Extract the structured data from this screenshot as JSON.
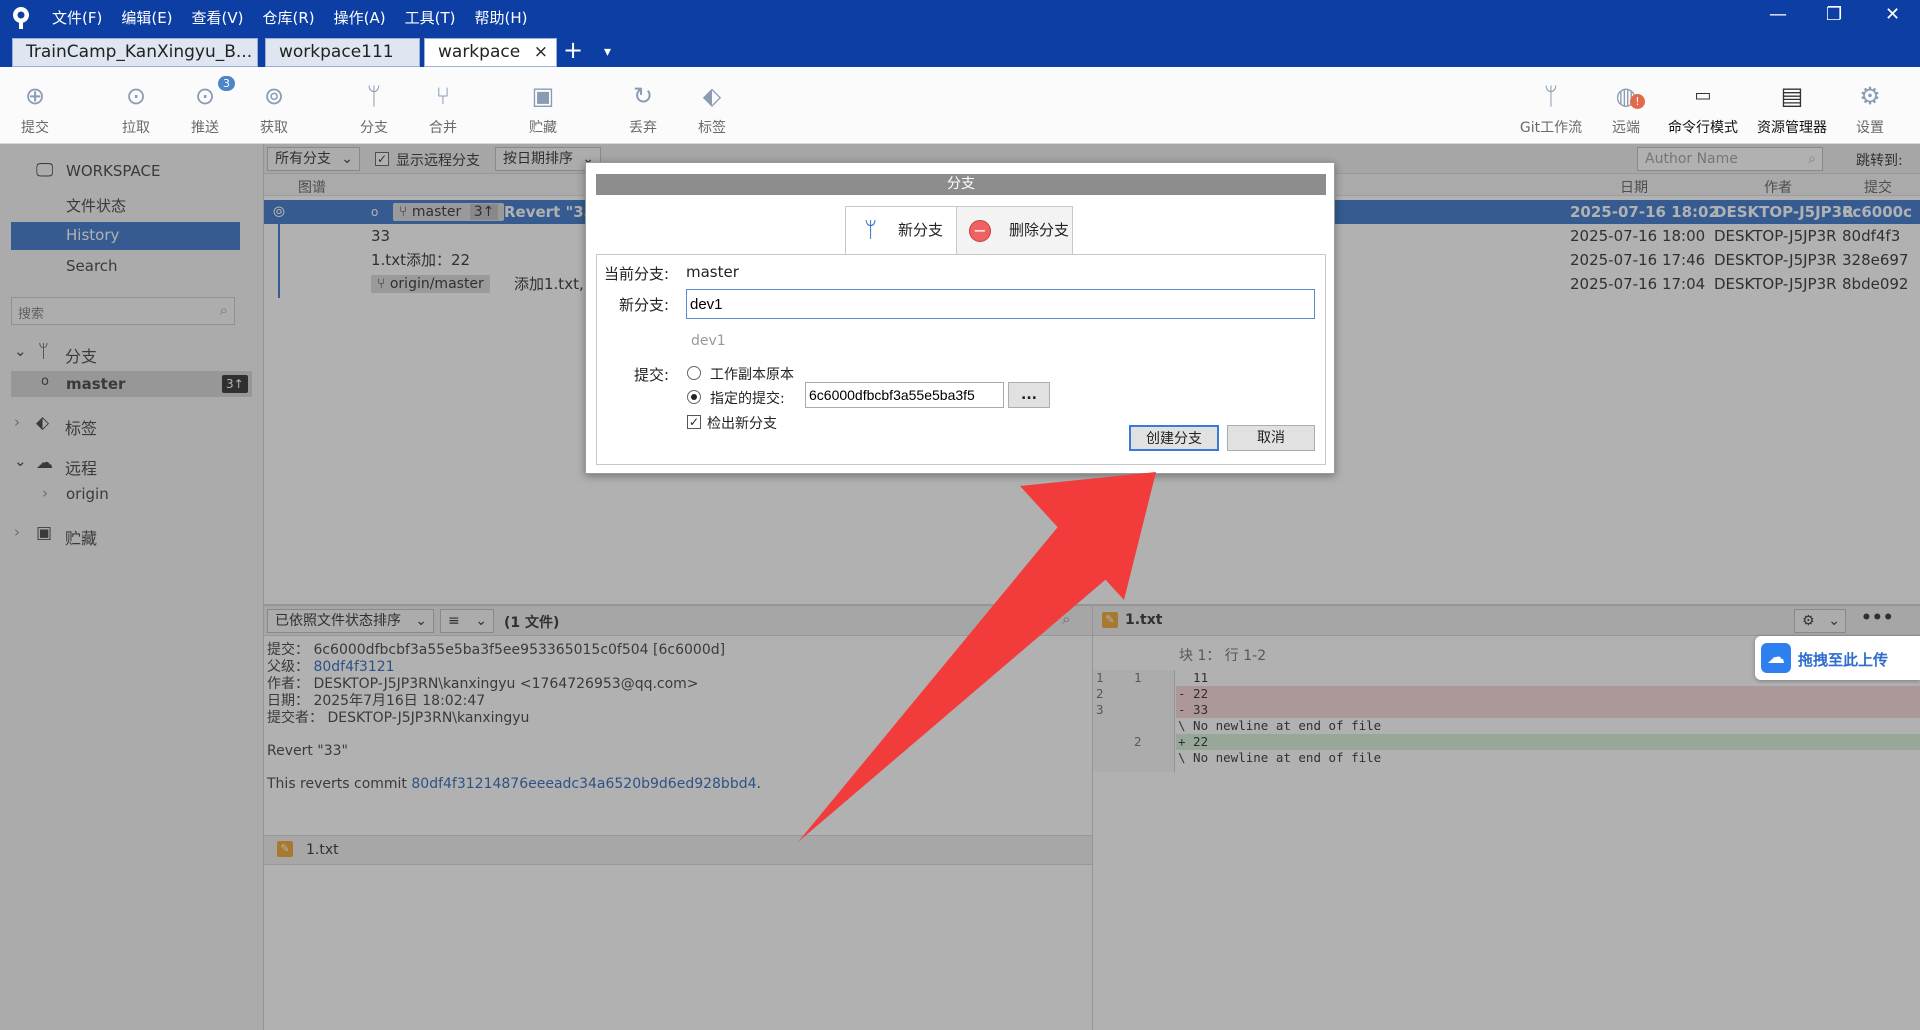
{
  "menu": [
    "文件(F)",
    "编辑(E)",
    "查看(V)",
    "仓库(R)",
    "操作(A)",
    "工具(T)",
    "帮助(H)"
  ],
  "tabs": [
    {
      "label": "TrainCamp_KanXingyu_B..."
    },
    {
      "label": "workpace111"
    },
    {
      "label": "warkpace",
      "close": "×"
    }
  ],
  "tab_add": "+",
  "tab_menu": "▾",
  "window_controls": {
    "minimize": "—",
    "restore": "❐",
    "close": "✕"
  },
  "toolbar": {
    "left": [
      {
        "label": "提交",
        "icon": "commit-icon"
      },
      {
        "label": "拉取",
        "icon": "pull-icon"
      },
      {
        "label": "推送",
        "icon": "push-icon",
        "badge": "3"
      },
      {
        "label": "获取",
        "icon": "fetch-icon"
      },
      {
        "label": "分支",
        "icon": "branch-icon"
      },
      {
        "label": "合并",
        "icon": "merge-icon"
      },
      {
        "label": "贮藏",
        "icon": "stash-icon"
      },
      {
        "label": "丢弃",
        "icon": "discard-icon"
      },
      {
        "label": "标签",
        "icon": "tag-icon"
      }
    ],
    "right": [
      {
        "label": "Git工作流",
        "icon": "git-flow-icon"
      },
      {
        "label": "远端",
        "icon": "remote-icon"
      },
      {
        "label": "命令行模式",
        "icon": "terminal-icon"
      },
      {
        "label": "资源管理器",
        "icon": "explorer-icon"
      },
      {
        "label": "设置",
        "icon": "gear-icon"
      }
    ]
  },
  "sidebar": {
    "workspace": "WORKSPACE",
    "items": [
      "文件状态",
      "History",
      "Search"
    ],
    "search_placeholder": "搜索",
    "branches": "分支",
    "master": "master",
    "master_badge": "3↑",
    "tags": "标签",
    "remotes": "远程",
    "origin": "origin",
    "stash": "贮藏"
  },
  "filterbar": {
    "branch_filter": "所有分支",
    "show_remote": "显示远程分支",
    "sort": "按日期排序",
    "author_placeholder": "Author Name",
    "jump": "跳转到:"
  },
  "columns": {
    "graph": "图谱",
    "date": "日期",
    "author": "作者",
    "commit": "提交"
  },
  "commits": [
    {
      "branch": "master",
      "badge": "3↑",
      "message": "Revert \"33",
      "date": "2025-07-16 18:02",
      "author": "DESKTOP-J5JP3R",
      "hash": "6c6000c"
    },
    {
      "message": "33",
      "date": "2025-07-16 18:00",
      "author": "DESKTOP-J5JP3R",
      "hash": "80df4f3"
    },
    {
      "message": "1.txt添加：22",
      "date": "2025-07-16 17:46",
      "author": "DESKTOP-J5JP3R",
      "hash": "328e697"
    },
    {
      "branch": "origin/master",
      "message": "添加1.txt,",
      "date": "2025-07-16 17:04",
      "author": "DESKTOP-J5JP3R",
      "hash": "8bde092"
    }
  ],
  "detail": {
    "sort": "已依照文件状态排序",
    "view": "≡",
    "count": "(1 文件)",
    "commit_label": "提交：",
    "commit": "6c6000dfbcbf3a55e5ba3f5ee953365015c0f504 [6c6000d]",
    "parent_label": "父级：",
    "parent": "80df4f3121",
    "author_label": "作者：",
    "author": "DESKTOP-J5JP3RN\\kanxingyu <1764726953@qq.com>",
    "date_label": "日期：",
    "date": "2025年7月16日 18:02:47",
    "committer_label": "提交者：",
    "committer": "DESKTOP-J5JP3RN\\kanxingyu",
    "msg1": "Revert \"33\"",
    "msg2_prefix": "This reverts commit ",
    "msg2_link": "80df4f31214876eeeadc34a6520b9d6ed928bbd4",
    "msg2_suffix": ".",
    "file": "1.txt"
  },
  "diff": {
    "file": "1.txt",
    "hunk": "块 1：  行 1-2",
    "lines": [
      {
        "old": "1",
        "new": "1",
        "text": "  11",
        "type": "ctx"
      },
      {
        "old": "2",
        "new": "",
        "text": "- 22",
        "type": "del"
      },
      {
        "old": "3",
        "new": "",
        "text": "- 33",
        "type": "del"
      },
      {
        "old": "",
        "new": "",
        "text": "\\ No newline at end of file",
        "type": "ctx"
      },
      {
        "old": "",
        "new": "2",
        "text": "+ 22",
        "type": "add"
      },
      {
        "old": "",
        "new": "",
        "text": "\\ No newline at end of file",
        "type": "ctx"
      }
    ]
  },
  "upload": "拖拽至此上传",
  "dialog": {
    "title": "分支",
    "tab_new": "新分支",
    "tab_delete": "删除分支",
    "current_label": "当前分支:",
    "current": "master",
    "new_label": "新分支:",
    "new_value": "dev1",
    "hint": "dev1",
    "commit_label": "提交:",
    "opt_working": "工作副本原本",
    "opt_specified": "指定的提交:",
    "specified_value": "6c6000dfbcbf3a55e5ba3f5",
    "browse": "...",
    "checkout": "检出新分支",
    "create": "创建分支",
    "cancel": "取消"
  },
  "colors": {
    "titlebar": "#0c3ea4",
    "selection": "#2a6cc7",
    "annotation_arrow": "#f23c3c"
  }
}
